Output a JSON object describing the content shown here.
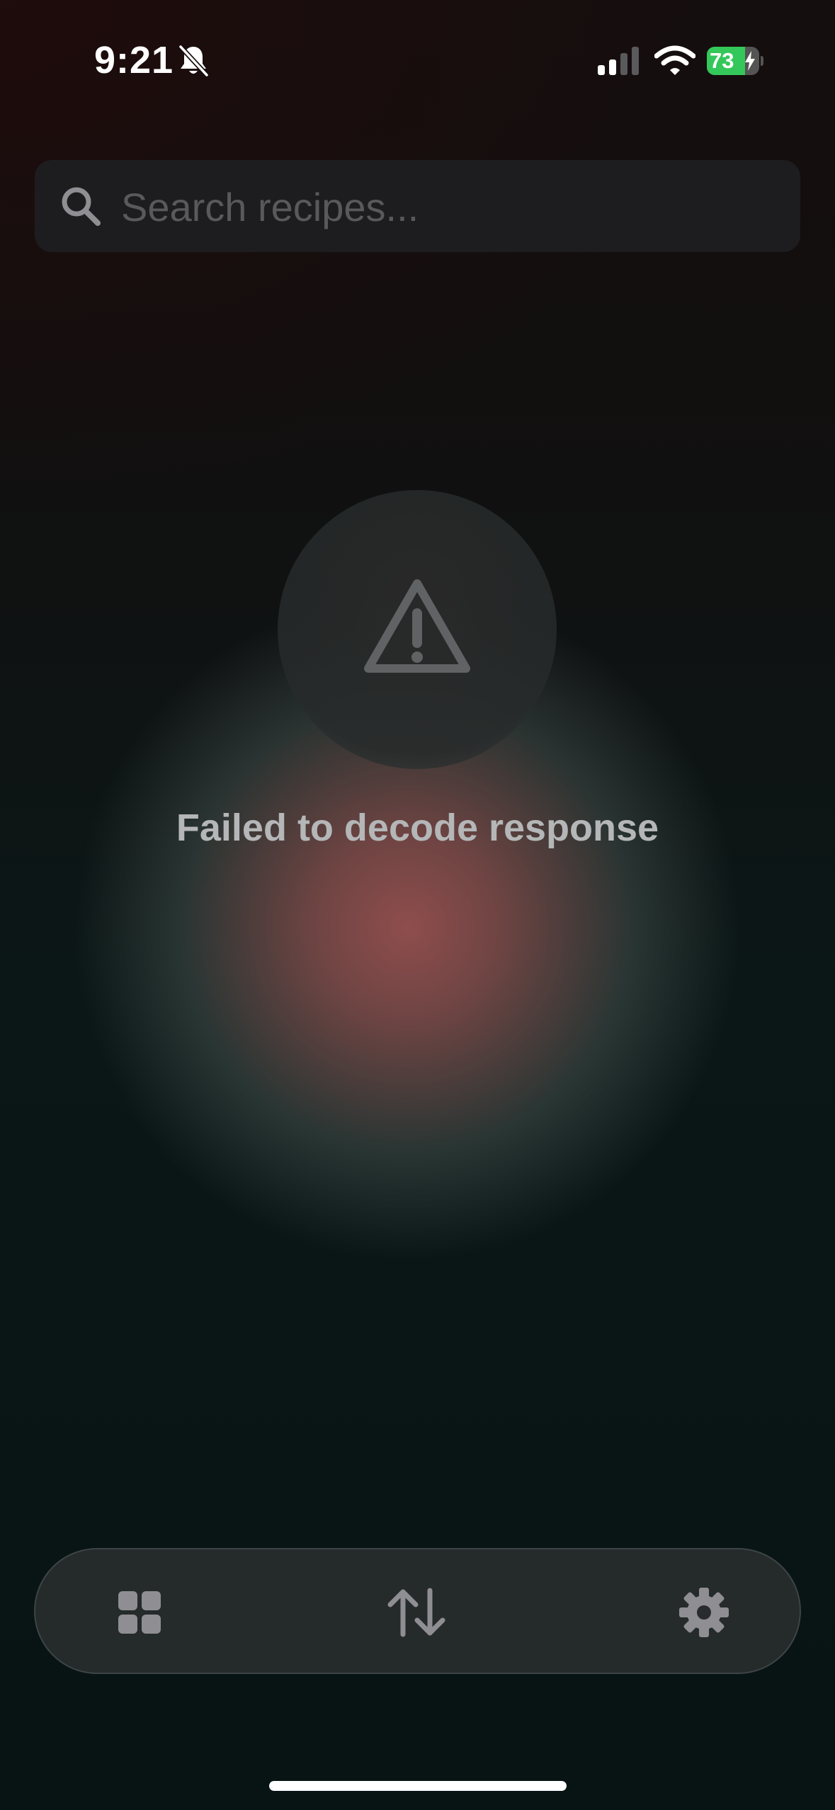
{
  "status_bar": {
    "time": "9:21",
    "battery_level": 73,
    "battery_label": "73",
    "battery_color": "#34c759",
    "icons": [
      "bell-slash-icon",
      "cellular-signal-icon",
      "wifi-icon",
      "battery-charging-icon"
    ]
  },
  "search": {
    "placeholder": "Search recipes...",
    "value": "",
    "icon": "magnifying-glass-icon"
  },
  "error": {
    "icon": "warning-triangle-icon",
    "message": "Failed to decode response"
  },
  "tab_bar": {
    "tabs": [
      {
        "icon": "grid-icon"
      },
      {
        "icon": "sort-arrows-icon"
      },
      {
        "icon": "gear-icon"
      }
    ]
  },
  "colors": {
    "background": "#0a1416",
    "surface": "#1d1d1f",
    "text_muted": "#b4b6b7",
    "icon_gray": "#8e8e93",
    "glow": "#965050"
  }
}
